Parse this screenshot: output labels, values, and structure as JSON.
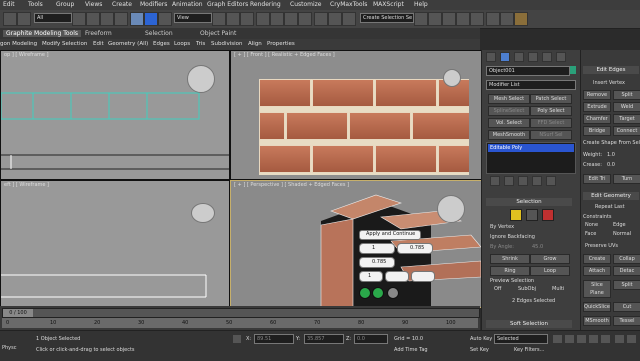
{
  "menubar": {
    "items": [
      "Edit",
      "Tools",
      "Group",
      "Views",
      "Create",
      "Modifiers",
      "Animation",
      "Graph Editors",
      "Rendering",
      "Customize",
      "CryMaxTools",
      "MAXScript",
      "Help"
    ]
  },
  "toolbar": {
    "filter_value": "All",
    "view_value": "View",
    "selection_set_placeholder": "Create Selection Se"
  },
  "ribbon": {
    "tabs": [
      "Graphite Modeling Tools",
      "Freeform",
      "Selection",
      "Object Paint"
    ],
    "subtabs": [
      "gon Modeling",
      "Modify Selection",
      "Edit",
      "Geometry (All)",
      "Edges",
      "Loops",
      "Tris",
      "Subdivision",
      "Align",
      "Properties"
    ]
  },
  "viewports": {
    "top_label": "op ] [ Wireframe ]",
    "front_label": "[ + ] [ Front ] [ Realistic + Edged Faces ]",
    "left_label": "eft ] [ Wireframe ]",
    "persp_label": "[ + ] [ Perspective ] [ Shaded + Edged Faces ]"
  },
  "caddy": {
    "title": "Apply and Continue",
    "val1": "1",
    "val2": "0.785",
    "val3": "0.785",
    "val4": "1"
  },
  "command_panel": {
    "object_name": "Object001",
    "modifier_list": "Modifier List",
    "buttons": [
      "Mesh Select",
      "Patch Select",
      "SplineSelect",
      "Poly Select",
      "Vol. Select",
      "FFD Select",
      "MeshSmooth",
      "NSurf Sel"
    ],
    "stack_item": "Editable Poly",
    "selection_title": "Selection",
    "by_vertex": "By Vertex",
    "ignore_backfacing": "Ignore Backfacing",
    "by_angle": "By Angle:",
    "by_angle_value": "45.0",
    "shrink": "Shrink",
    "grow": "Grow",
    "ring": "Ring",
    "loop": "Loop",
    "preview_selection": "Preview Selection",
    "preview_off": "Off",
    "preview_subobj": "SubObj",
    "preview_multi": "Multi",
    "status": "2 Edges Selected",
    "soft_selection": "Soft Selection"
  },
  "right_panel": {
    "edit_edges_title": "Edit Edges",
    "insert_vertex": "Insert Vertex",
    "remove": "Remove",
    "split": "Split",
    "extrude": "Extrude",
    "weld": "Weld",
    "chamfer": "Chamfer",
    "target": "Target",
    "bridge": "Bridge",
    "connect": "Connect",
    "create_shape": "Create Shape From Sel",
    "weight_label": "Weight:",
    "weight_value": "1.0",
    "crease_label": "Crease:",
    "crease_value": "0.0",
    "edit_tri": "Edit Tri",
    "turn": "Turn",
    "edit_geometry_title": "Edit Geometry",
    "repeat_last": "Repeat Last",
    "constraints": "Constraints",
    "c_none": "None",
    "c_edge": "Edge",
    "c_face": "Face",
    "c_normal": "Normal",
    "preserve_uvs": "Preserve UVs",
    "create": "Create",
    "collapse": "Collap",
    "attach": "Attach",
    "detach": "Detac",
    "slice_plane": "Slice Plane",
    "split2": "Split",
    "quickslice": "QuickSlice",
    "cut": "Cut",
    "msmooth": "MSmooth",
    "tessellate": "Tessel"
  },
  "timeline": {
    "frame_counter": "0 / 100",
    "ticks": [
      "0",
      "10",
      "20",
      "30",
      "40",
      "50",
      "60",
      "70",
      "80",
      "90",
      "100"
    ]
  },
  "status": {
    "line1": "1 Object Selected",
    "line2": "Click or click-and-drag to select objects",
    "x_label": "X:",
    "x_value": "89.51",
    "y_label": "Y:",
    "y_value": "35.857",
    "z_label": "Z:",
    "z_value": "0.0",
    "grid": "Grid = 10.0",
    "add_time_tag": "Add Time Tag",
    "auto_key": "Auto Key",
    "set_key": "Set Key",
    "selected": "Selected",
    "key_filters": "Key Filters...",
    "physx": "Physc"
  },
  "colors": {
    "accent": "#c8b050",
    "poly_select": "#2a55d0",
    "brick": "#b8654a"
  }
}
